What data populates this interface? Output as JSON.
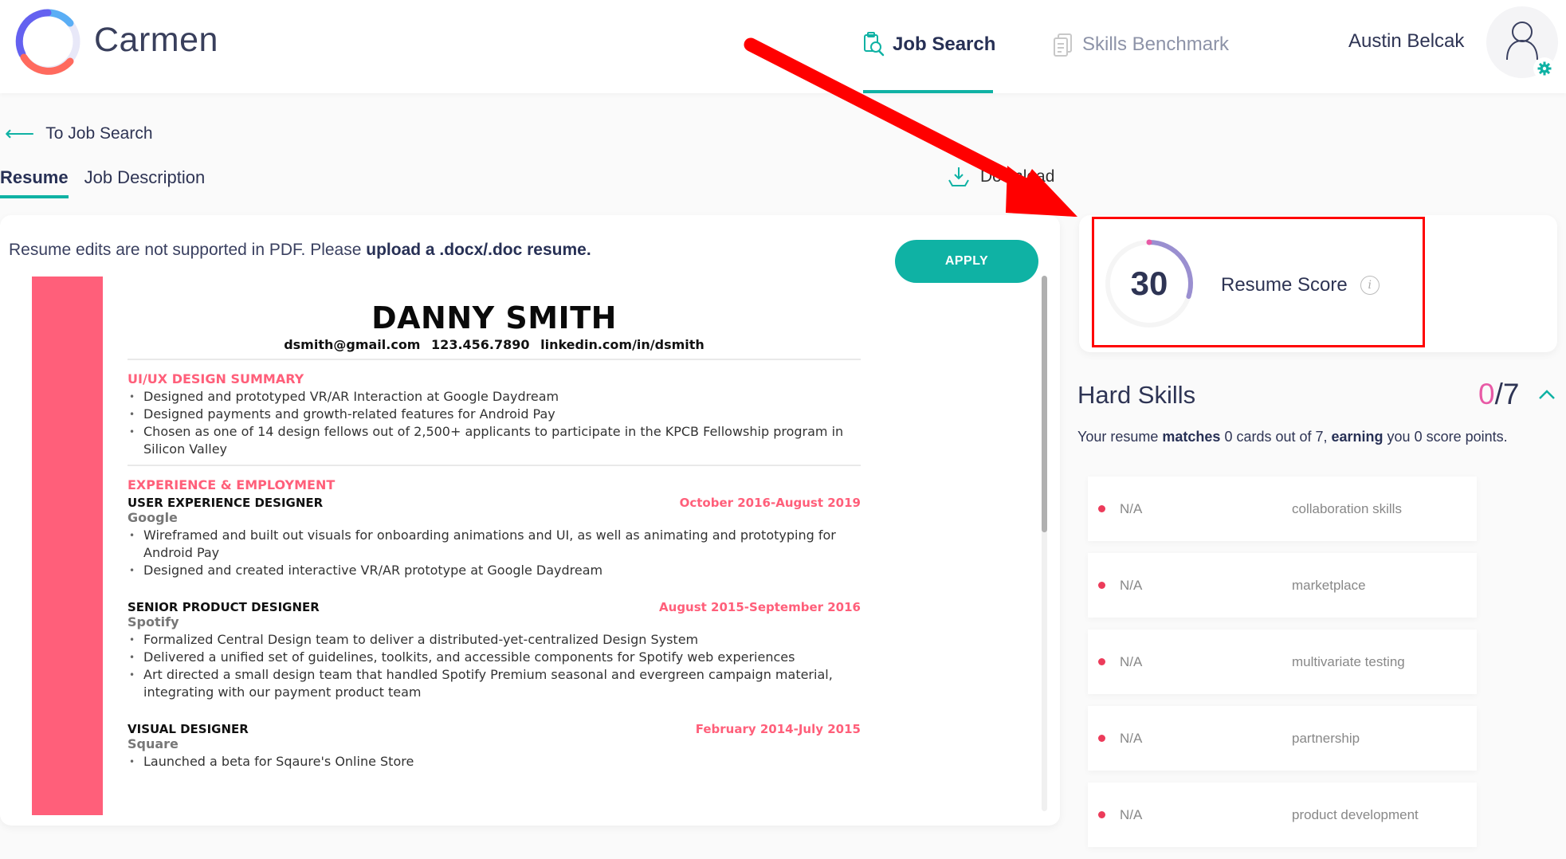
{
  "header": {
    "brand": "Carmen",
    "nav": [
      {
        "label": "Job Search",
        "active": true
      },
      {
        "label": "Skills Benchmark",
        "active": false
      }
    ],
    "user_name": "Austin Belcak"
  },
  "page": {
    "back_link": "To Job Search",
    "tabs": [
      {
        "label": "Resume",
        "active": true
      },
      {
        "label": "Job Description",
        "active": false
      }
    ],
    "download_label": "Download"
  },
  "resume_panel": {
    "notice_text": "Resume edits are not supported in PDF. Please ",
    "notice_bold": "upload a .docx/.doc resume.",
    "apply_label": "APPLY",
    "document": {
      "name": "DANNY SMITH",
      "contact": "dsmith@gmail.com 123.456.7890 linkedin.com/in/dsmith",
      "accent_color": "#ff5f7a",
      "summary_heading": "UI/UX DESIGN SUMMARY",
      "summary_bullets": [
        "Designed and prototyped VR/AR Interaction at Google Daydream",
        "Designed payments and growth-related features for Android Pay",
        "Chosen as one of 14 design fellows out of 2,500+ applicants to participate in the KPCB Fellowship program in Silicon Valley"
      ],
      "experience_heading": "EXPERIENCE & EMPLOYMENT",
      "jobs": [
        {
          "title": "USER EXPERIENCE DESIGNER",
          "dates": "October 2016-August 2019",
          "company": "Google",
          "bullets": [
            "Wireframed and built out visuals for onboarding animations and UI, as well as animating and prototyping for Android Pay",
            "Designed and created interactive VR/AR prototype at Google Daydream"
          ]
        },
        {
          "title": "SENIOR PRODUCT DESIGNER",
          "dates": "August 2015-September 2016",
          "company": "Spotify",
          "bullets": [
            "Formalized Central Design team to deliver a distributed-yet-centralized Design System",
            "Delivered a unified set of guidelines, toolkits, and accessible components for Spotify web experiences",
            "Art directed a small design team that handled Spotify Premium seasonal and evergreen campaign material, integrating with our payment product team"
          ]
        },
        {
          "title": "VISUAL DESIGNER",
          "dates": "February 2014-July 2015",
          "company": "Square",
          "bullets": [
            "Launched a beta for Sqaure's Online Store"
          ]
        }
      ]
    }
  },
  "score": {
    "value": "30",
    "value_fraction": 0.3,
    "label": "Resume Score",
    "info_glyph": "i"
  },
  "hard_skills": {
    "title": "Hard Skills",
    "matched": "0",
    "total": "/7",
    "summary_pre": "Your resume ",
    "summary_b1": "matches",
    "summary_mid": " 0 cards out of 7, ",
    "summary_b2": "earning",
    "summary_post": " you 0 score points.",
    "items": [
      {
        "status": "N/A",
        "name": "collaboration skills"
      },
      {
        "status": "N/A",
        "name": "marketplace"
      },
      {
        "status": "N/A",
        "name": "multivariate testing"
      },
      {
        "status": "N/A",
        "name": "partnership"
      },
      {
        "status": "N/A",
        "name": "product development"
      }
    ]
  },
  "colors": {
    "accent": "#0fb2a4",
    "annotation": "#ff0000",
    "missing_dot": "#ec3b5a",
    "score_arc": "#9a8fd0"
  }
}
